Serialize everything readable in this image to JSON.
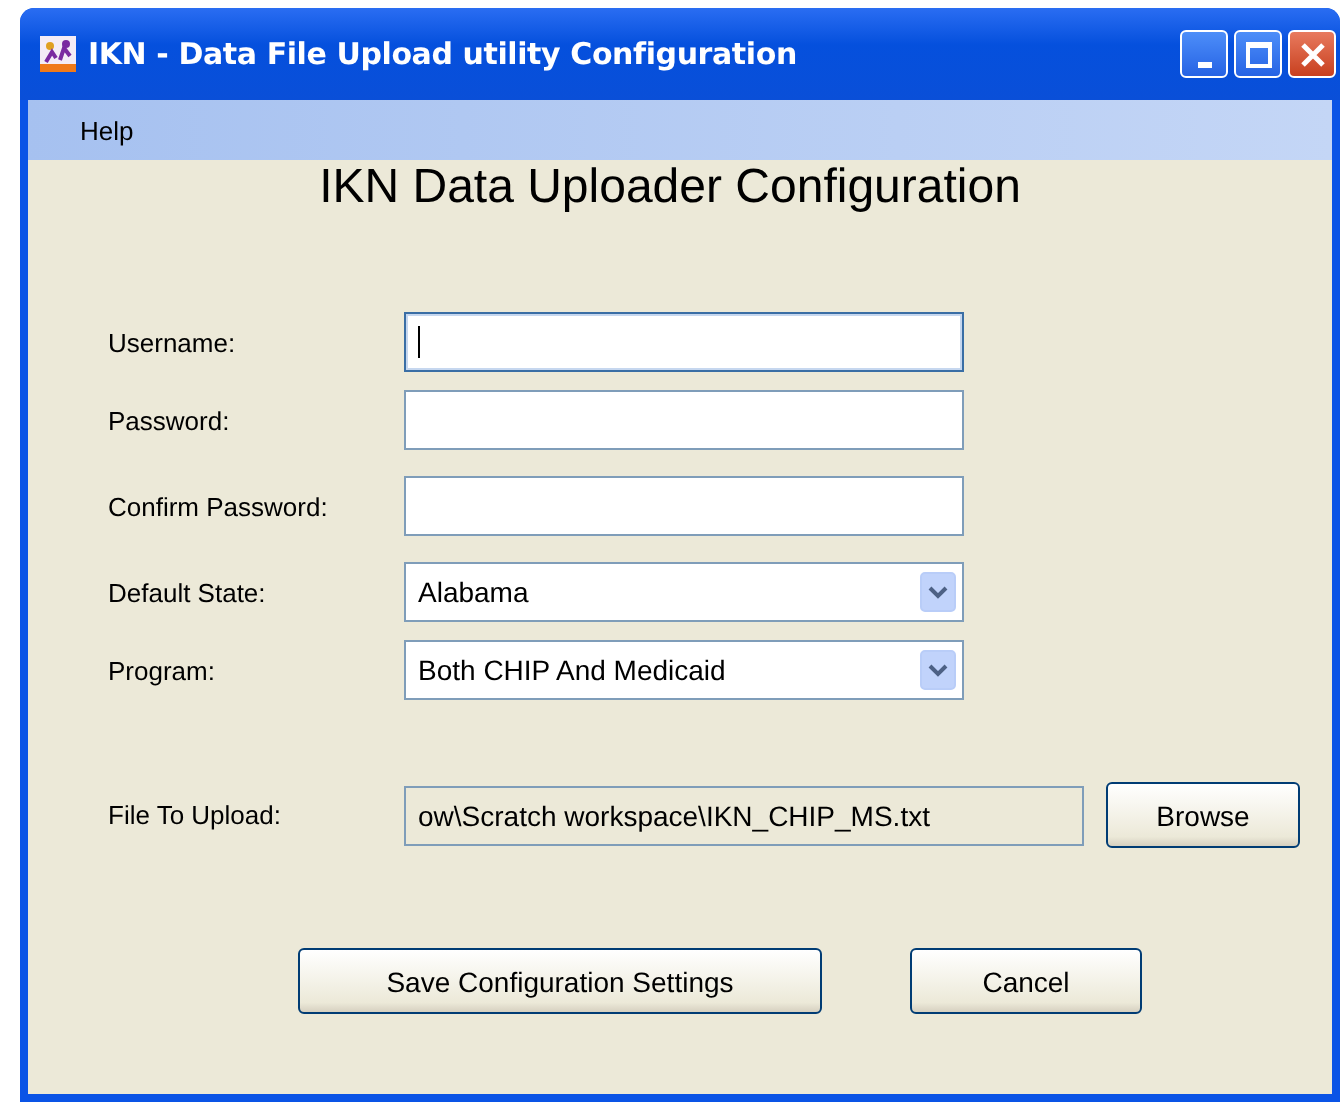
{
  "window": {
    "title": "IKN - Data File Upload utility Configuration"
  },
  "menu": [
    "Help"
  ],
  "heading": "IKN Data Uploader Configuration",
  "fields": [
    {
      "kind": "text",
      "label": "Username:",
      "focused": true
    },
    {
      "kind": "password",
      "label": "Password:",
      "focused": false
    },
    {
      "kind": "password",
      "label": "Confirm Password:",
      "focused": false
    },
    {
      "kind": "select",
      "label": "Default State:",
      "value": "Alabama",
      "focused": false
    },
    {
      "kind": "select",
      "label": "Program:",
      "value": "Both CHIP And Medicaid",
      "focused": false
    },
    {
      "kind": "file",
      "label": "File To Upload:",
      "value": "ow\\Scratch workspace\\IKN_CHIP_MS.txt",
      "button": "Browse",
      "focused": false
    }
  ],
  "buttons": [
    "Save Configuration Settings",
    "Cancel"
  ]
}
